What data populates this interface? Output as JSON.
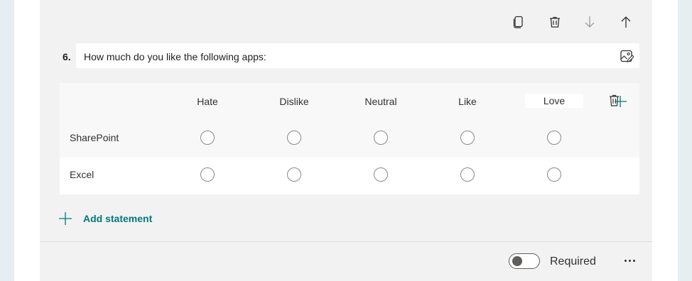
{
  "question": {
    "number": "6.",
    "title": "How much do you like the following apps:"
  },
  "toolbar": {
    "icons": [
      "copy-icon",
      "delete-icon",
      "move-down-icon",
      "move-up-icon"
    ]
  },
  "likert": {
    "columns": [
      "Hate",
      "Dislike",
      "Neutral",
      "Like",
      "Love"
    ],
    "statements": [
      "SharePoint",
      "Excel"
    ]
  },
  "actions": {
    "add_statement": "Add statement"
  },
  "footer": {
    "required_label": "Required",
    "required_on": false
  },
  "colors": {
    "accent": "#03787c",
    "card": "#f2f2f2",
    "page": "#e6eef2"
  }
}
